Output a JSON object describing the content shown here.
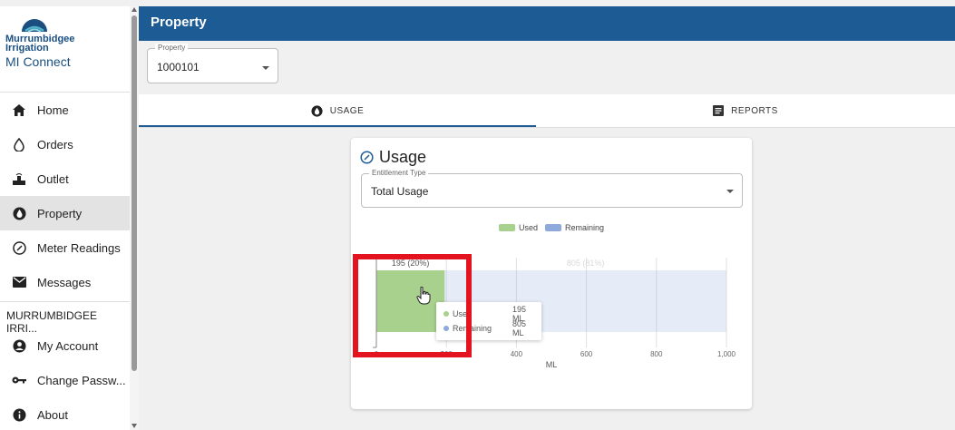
{
  "sidebar": {
    "brand_line1": "Murrumbidgee",
    "brand_line2": "Irrigation",
    "app_name": "MI Connect",
    "items": [
      {
        "label": "Home",
        "icon": "home-icon"
      },
      {
        "label": "Orders",
        "icon": "water-drop-icon"
      },
      {
        "label": "Outlet",
        "icon": "outlet-icon"
      },
      {
        "label": "Property",
        "icon": "property-icon",
        "active": true
      },
      {
        "label": "Meter Readings",
        "icon": "gauge-icon"
      },
      {
        "label": "Messages",
        "icon": "mail-icon"
      }
    ],
    "section_label": "MURRUMBIDGEE IRRI...",
    "account_items": [
      {
        "label": "My Account",
        "icon": "account-icon"
      },
      {
        "label": "Change Passw...",
        "icon": "key-icon"
      },
      {
        "label": "About",
        "icon": "info-icon"
      }
    ]
  },
  "header": {
    "title": "Property"
  },
  "property_select": {
    "label": "Property",
    "value": "1000101"
  },
  "tabs": [
    {
      "label": "USAGE",
      "icon": "property-icon",
      "selected": true
    },
    {
      "label": "REPORTS",
      "icon": "report-icon",
      "selected": false
    }
  ],
  "card": {
    "title": "Usage",
    "entitlement": {
      "label": "Entitlement Type",
      "value": "Total Usage"
    }
  },
  "chart_data": {
    "type": "bar",
    "orientation": "horizontal",
    "stacked": true,
    "categories": [
      "Total Usage"
    ],
    "series": [
      {
        "name": "Used",
        "values": [
          195
        ],
        "color": "#a9d18e",
        "data_label": "195 (20%)"
      },
      {
        "name": "Remaining",
        "values": [
          805
        ],
        "color": "#8ea9db",
        "data_label": "805 (81%)"
      }
    ],
    "xlim": [
      0,
      1000
    ],
    "xticks": [
      "0",
      "200",
      "400",
      "600",
      "800",
      "1,000"
    ],
    "xlabel": "ML",
    "grid": true,
    "legend": "top-center"
  },
  "tooltip": {
    "rows": [
      {
        "name": "Used",
        "value": "195 ML",
        "color": "#a9d18e"
      },
      {
        "name": "Remaining",
        "value": "805 ML",
        "color": "#8ea9db"
      }
    ]
  },
  "colors": {
    "header": "#1d5b94",
    "brand": "#1a4f80",
    "highlight": "#e3141f"
  }
}
